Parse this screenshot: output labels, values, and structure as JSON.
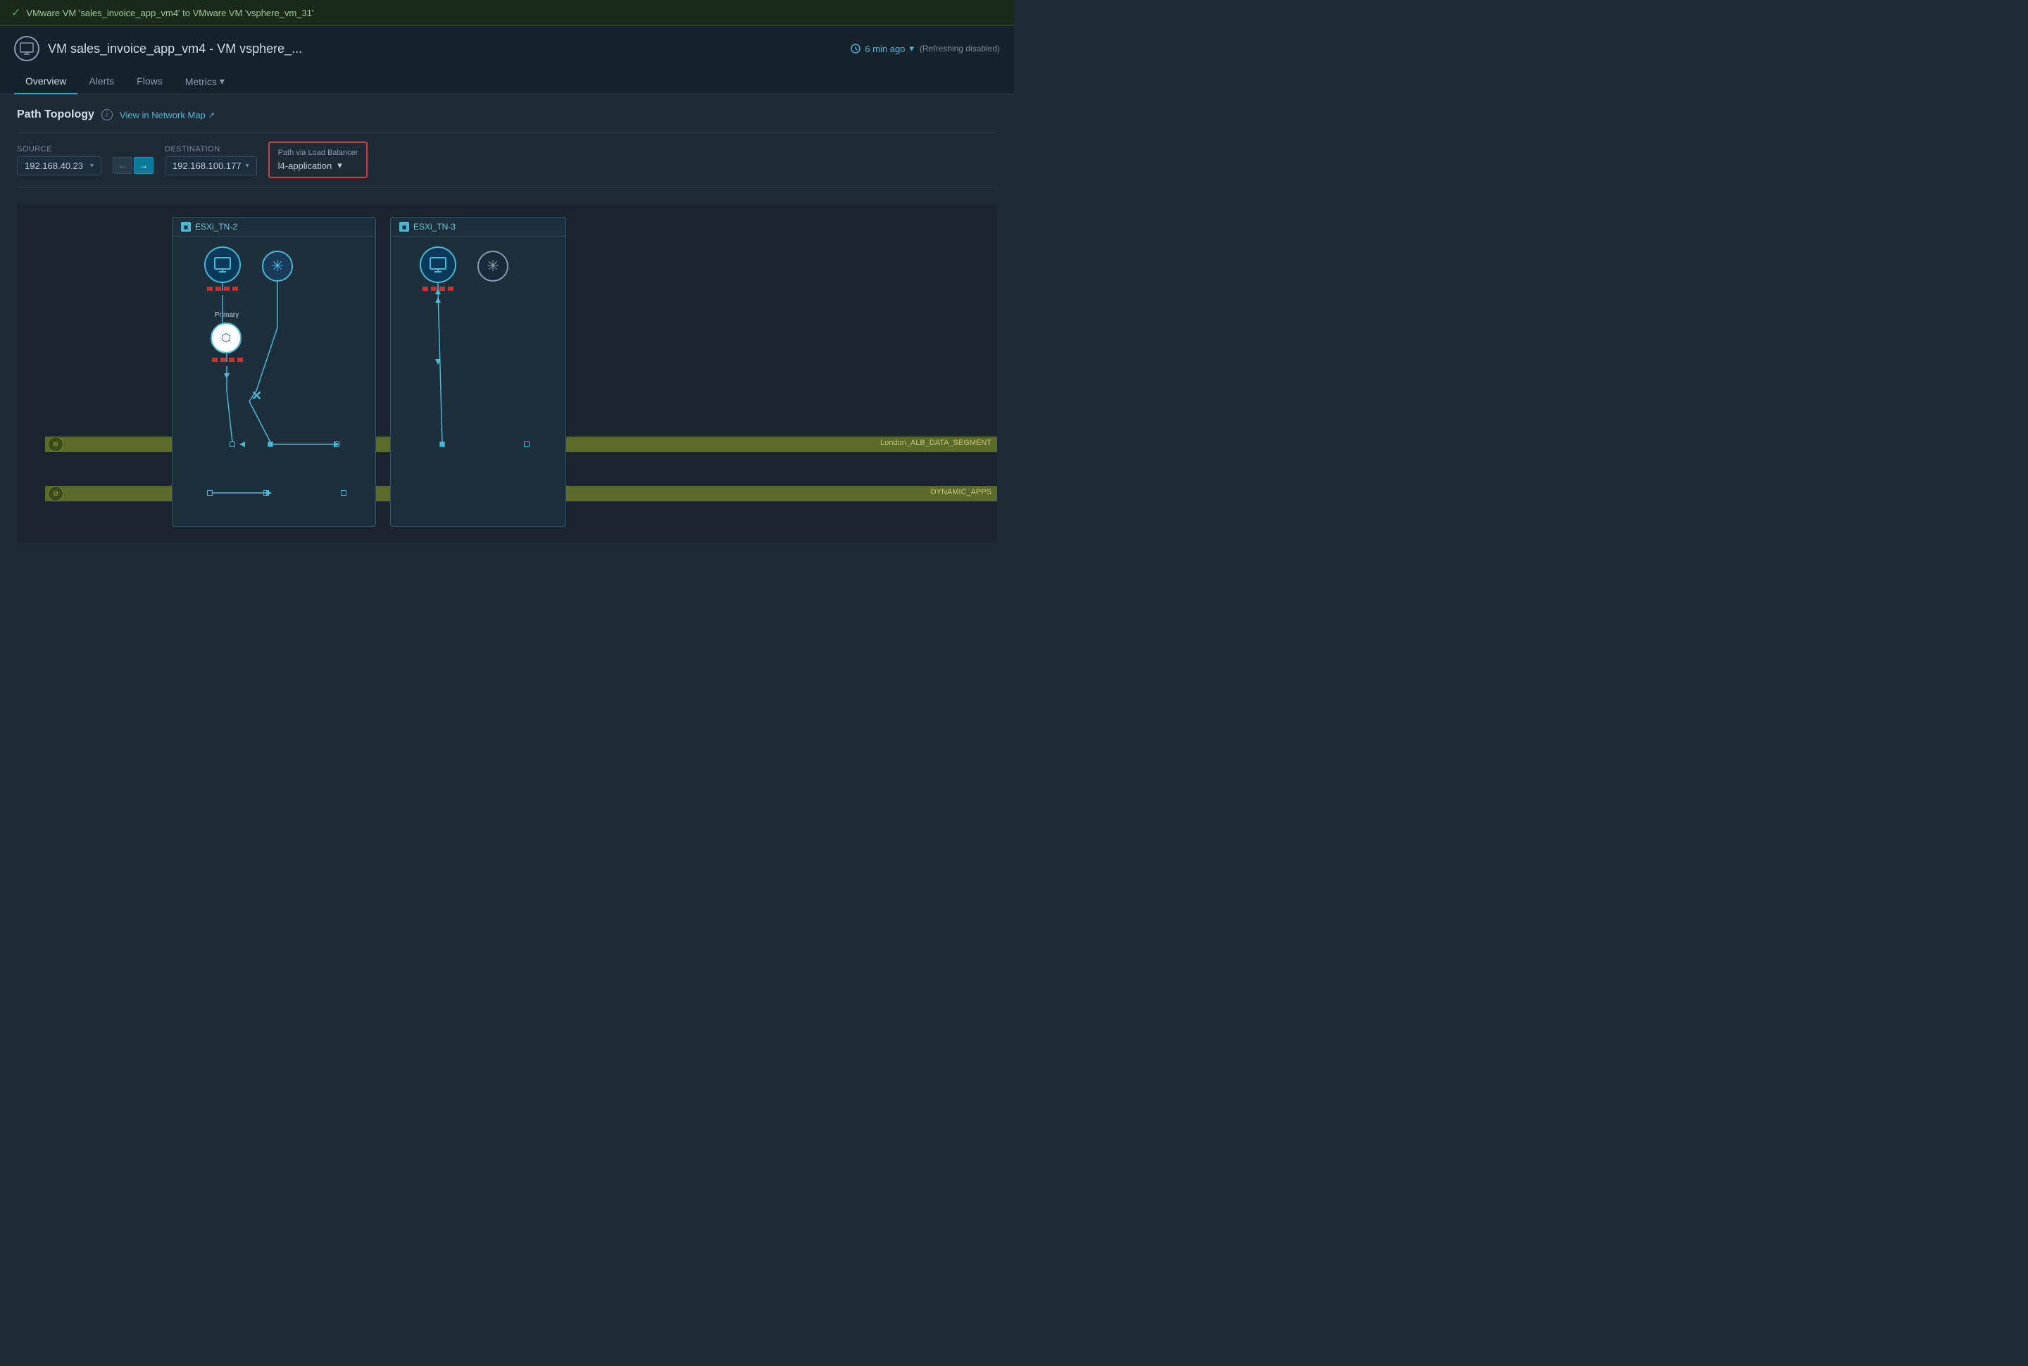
{
  "notification": {
    "icon": "✓",
    "text": "VMware VM 'sales_invoice_app_vm4' to VMware VM 'vsphere_vm_31'"
  },
  "header": {
    "vm_icon": "🖥",
    "title": "VM sales_invoice_app_vm4 - VM vsphere_...",
    "time_ago": "6 min ago",
    "refreshing": "(Refreshing  disabled)"
  },
  "tabs": [
    {
      "label": "Overview",
      "active": true
    },
    {
      "label": "Alerts",
      "active": false
    },
    {
      "label": "Flows",
      "active": false
    },
    {
      "label": "Metrics",
      "active": false,
      "has_arrow": true
    }
  ],
  "section": {
    "title": "Path Topology",
    "network_map_link": "View in Network Map"
  },
  "path_controls": {
    "source_label": "Source",
    "source_value": "192.168.40.23",
    "destination_label": "Destination",
    "destination_value": "192.168.100.177",
    "lb_label": "Path via Load Balancer",
    "lb_value": "l4-application"
  },
  "topology": {
    "esxi_tn2": "ESXi_TN-2",
    "esxi_tn3": "ESXi_TN-3",
    "segment1_label": "London_ALB_DATA_SEGMENT",
    "segment2_label": "DYNAMIC_APPS",
    "router_label": "Primary"
  }
}
